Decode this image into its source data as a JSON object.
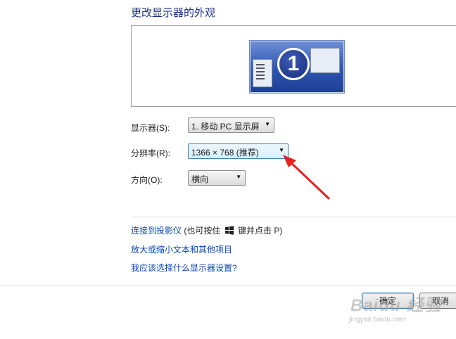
{
  "header": {
    "title": "更改显示器的外观"
  },
  "preview": {
    "monitor_number": "1"
  },
  "settings": {
    "display_label": "显示器(S):",
    "display_value": "1. 移动 PC 显示屏",
    "resolution_label": "分辨率(R):",
    "resolution_value": "1366 × 768 (推荐)",
    "orientation_label": "方向(O):",
    "orientation_value": "横向"
  },
  "links": {
    "projector_link": "连接到投影仪",
    "projector_hint_prefix": "(也可按住",
    "projector_hint_suffix": "键并点击 P)",
    "text_size_link": "放大或缩小文本和其他项目",
    "help_link": "我应该选择什么显示器设置?"
  },
  "buttons": {
    "ok": "确定",
    "cancel": "取消"
  },
  "watermark": {
    "text": "Baidu 经验",
    "url": "jingyan.baidu.com"
  },
  "colors": {
    "link": "#0645b5",
    "title": "#1e3287",
    "annotation_arrow": "#e8201f"
  },
  "icons": {
    "windows_key": "windows-logo-icon",
    "dropdown": "chevron-down-icon"
  }
}
